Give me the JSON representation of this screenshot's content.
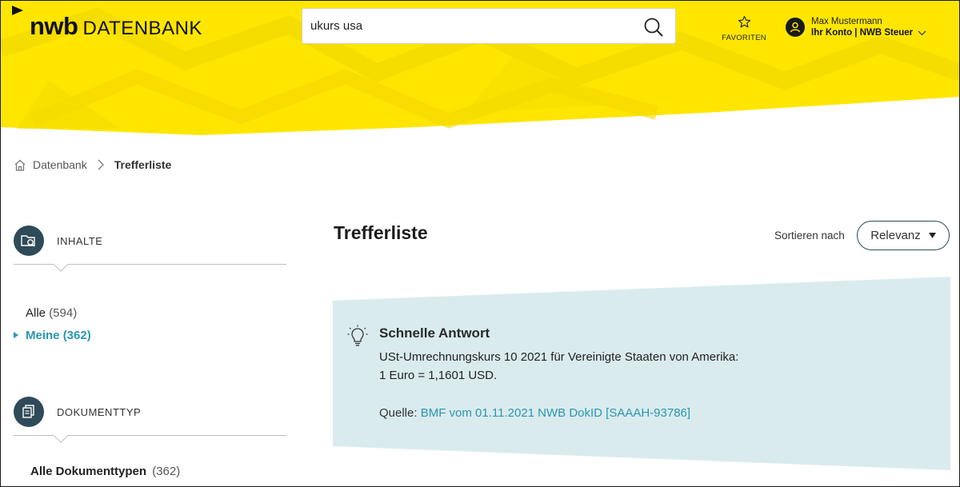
{
  "header": {
    "logo_brand": "nwb",
    "logo_sub": "DATENBANK",
    "search_value": "ukurs usa",
    "favorites_label": "FAVORITEN",
    "user_name": "Max Mustermann",
    "account_label": "Ihr Konto | NWB Steuer",
    "brand_color": "#ffe600"
  },
  "breadcrumb": {
    "home": "Datenbank",
    "current": "Trefferliste"
  },
  "sidebar": {
    "inhalte": {
      "title": "INHALTE",
      "items": [
        {
          "label": "Alle",
          "count": "(594)"
        },
        {
          "label": "Meine",
          "count": "(362)"
        }
      ]
    },
    "dokumenttyp": {
      "title": "DOKUMENTTYP",
      "items": [
        {
          "label": "Alle Dokumenttypen",
          "count": "(362)"
        }
      ]
    }
  },
  "main": {
    "title": "Trefferliste",
    "sort_label": "Sortieren nach",
    "sort_value": "Relevanz",
    "quick_answer": {
      "title": "Schnelle Antwort",
      "line1": "USt-Umrechnungskurs 10 2021 für Vereinigte Staaten von Amerika:",
      "line2": "1 Euro = 1,1601 USD.",
      "source_label": "Quelle:",
      "source_link": "BMF vom 01.11.2021 NWB DokID [SAAAH-93786]"
    },
    "accent_color": "#2b96b0",
    "panel_color": "#daebee"
  }
}
